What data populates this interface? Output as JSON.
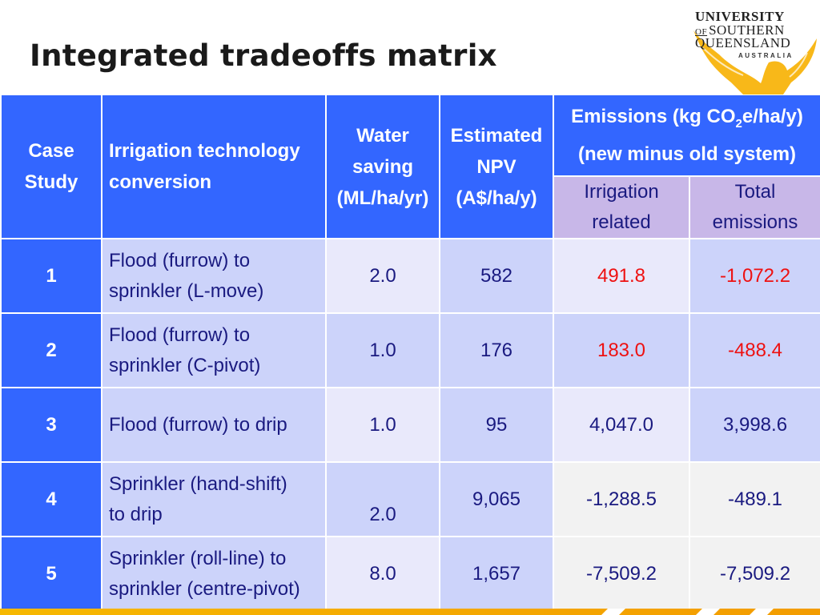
{
  "slide": {
    "title": "Integrated tradeoffs matrix"
  },
  "logo": {
    "line1": "UNIVERSITY",
    "line2_of": "OF",
    "line2": "SOUTHERN",
    "line3": "QUEENSLAND",
    "line4": "AUSTRALIA",
    "icon": "phoenix-icon"
  },
  "colors": {
    "header_blue": "#3366ff",
    "subheader_purple": "#c8b7e8",
    "cell_medium": "#ccd3fa",
    "cell_light": "#e9e9fb",
    "cell_grey": "#f2f2f2",
    "text_navy": "#1a1a80",
    "text_red": "#ee1111",
    "accent_gold": "#f6b800"
  },
  "table": {
    "headers": {
      "case_study": [
        "Case",
        "Study"
      ],
      "technology": [
        "Irrigation technology",
        "conversion"
      ],
      "water_saving": [
        "Water",
        "saving",
        "(ML/ha/yr)"
      ],
      "npv": [
        "Estimated",
        "NPV",
        "(A$/ha/y)"
      ],
      "emissions_pre": "Emissions (kg CO",
      "emissions_sub": "2",
      "emissions_post": "e/ha/y)",
      "emissions_line2": "(new minus old system)",
      "irrigation_related": [
        "Irrigation",
        "related"
      ],
      "total_emissions": [
        "Total",
        "emissions"
      ]
    },
    "rows": [
      {
        "case": "1",
        "technology": [
          "Flood (furrow) to",
          "sprinkler (L-move)"
        ],
        "water": "2.0",
        "npv": "582",
        "irrigation": "491.8",
        "total": "-1,072.2"
      },
      {
        "case": "2",
        "technology": [
          "Flood (furrow) to",
          "sprinkler (C-pivot)"
        ],
        "water": "1.0",
        "npv": "176",
        "irrigation": "183.0",
        "total": "-488.4"
      },
      {
        "case": "3",
        "technology": [
          "Flood (furrow) to drip",
          ""
        ],
        "water": "1.0",
        "npv": "95",
        "irrigation": "4,047.0",
        "total": "3,998.6"
      },
      {
        "case": "4",
        "technology": [
          "Sprinkler (hand-shift)",
          "to drip"
        ],
        "water": "2.0",
        "npv": "9,065",
        "irrigation": "-1,288.5",
        "total": "-489.1"
      },
      {
        "case": "5",
        "technology": [
          "Sprinkler (roll-line) to",
          "sprinkler (centre-pivot)"
        ],
        "water": "8.0",
        "npv": "1,657",
        "irrigation": "-7,509.2",
        "total": "-7,509.2"
      }
    ]
  }
}
